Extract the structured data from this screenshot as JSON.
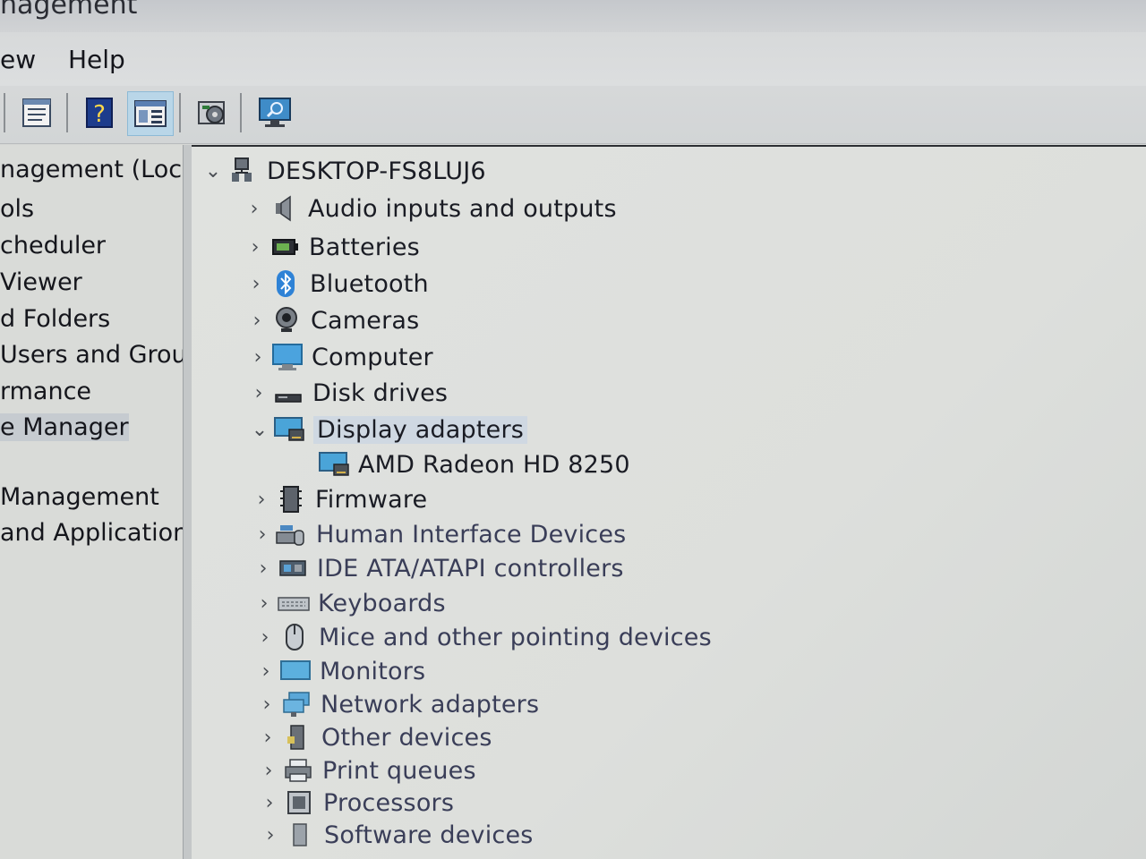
{
  "window": {
    "title": "nagement"
  },
  "menu": {
    "view": "ew",
    "help": "Help"
  },
  "toolbar": {
    "icons": [
      "properties-icon",
      "help-icon",
      "show-hide-console-tree-icon",
      "update-driver-icon",
      "scan-hardware-icon"
    ]
  },
  "left_tree": {
    "items": [
      {
        "label": "nagement (Local"
      },
      {
        "label": "ols"
      },
      {
        "label": "cheduler"
      },
      {
        "label": "Viewer"
      },
      {
        "label": "d Folders"
      },
      {
        "label": "Users and Groups"
      },
      {
        "label": "rmance"
      },
      {
        "label": "e Manager"
      },
      {
        "label": "Management"
      },
      {
        "label": "and Applications"
      }
    ]
  },
  "device_tree": {
    "root": "DESKTOP-FS8LUJ6",
    "categories": [
      {
        "label": "Audio inputs and outputs",
        "icon": "speaker-icon"
      },
      {
        "label": "Batteries",
        "icon": "battery-icon"
      },
      {
        "label": "Bluetooth",
        "icon": "bluetooth-icon"
      },
      {
        "label": "Cameras",
        "icon": "camera-icon"
      },
      {
        "label": "Computer",
        "icon": "computer-icon"
      },
      {
        "label": "Disk drives",
        "icon": "disk-drive-icon"
      },
      {
        "label": "Display adapters",
        "icon": "display-adapter-icon"
      },
      {
        "label": "AMD Radeon HD 8250",
        "icon": "display-adapter-icon"
      },
      {
        "label": "Firmware",
        "icon": "firmware-icon"
      },
      {
        "label": "Human Interface Devices",
        "icon": "hid-icon"
      },
      {
        "label": "IDE ATA/ATAPI controllers",
        "icon": "ide-controller-icon"
      },
      {
        "label": "Keyboards",
        "icon": "keyboard-icon"
      },
      {
        "label": "Mice and other pointing devices",
        "icon": "mouse-icon"
      },
      {
        "label": "Monitors",
        "icon": "monitor-icon"
      },
      {
        "label": "Network adapters",
        "icon": "network-adapter-icon"
      },
      {
        "label": "Other devices",
        "icon": "other-devices-icon"
      },
      {
        "label": "Print queues",
        "icon": "printer-icon"
      },
      {
        "label": "Processors",
        "icon": "processor-icon"
      },
      {
        "label": "Software devices",
        "icon": "software-device-icon"
      }
    ]
  }
}
